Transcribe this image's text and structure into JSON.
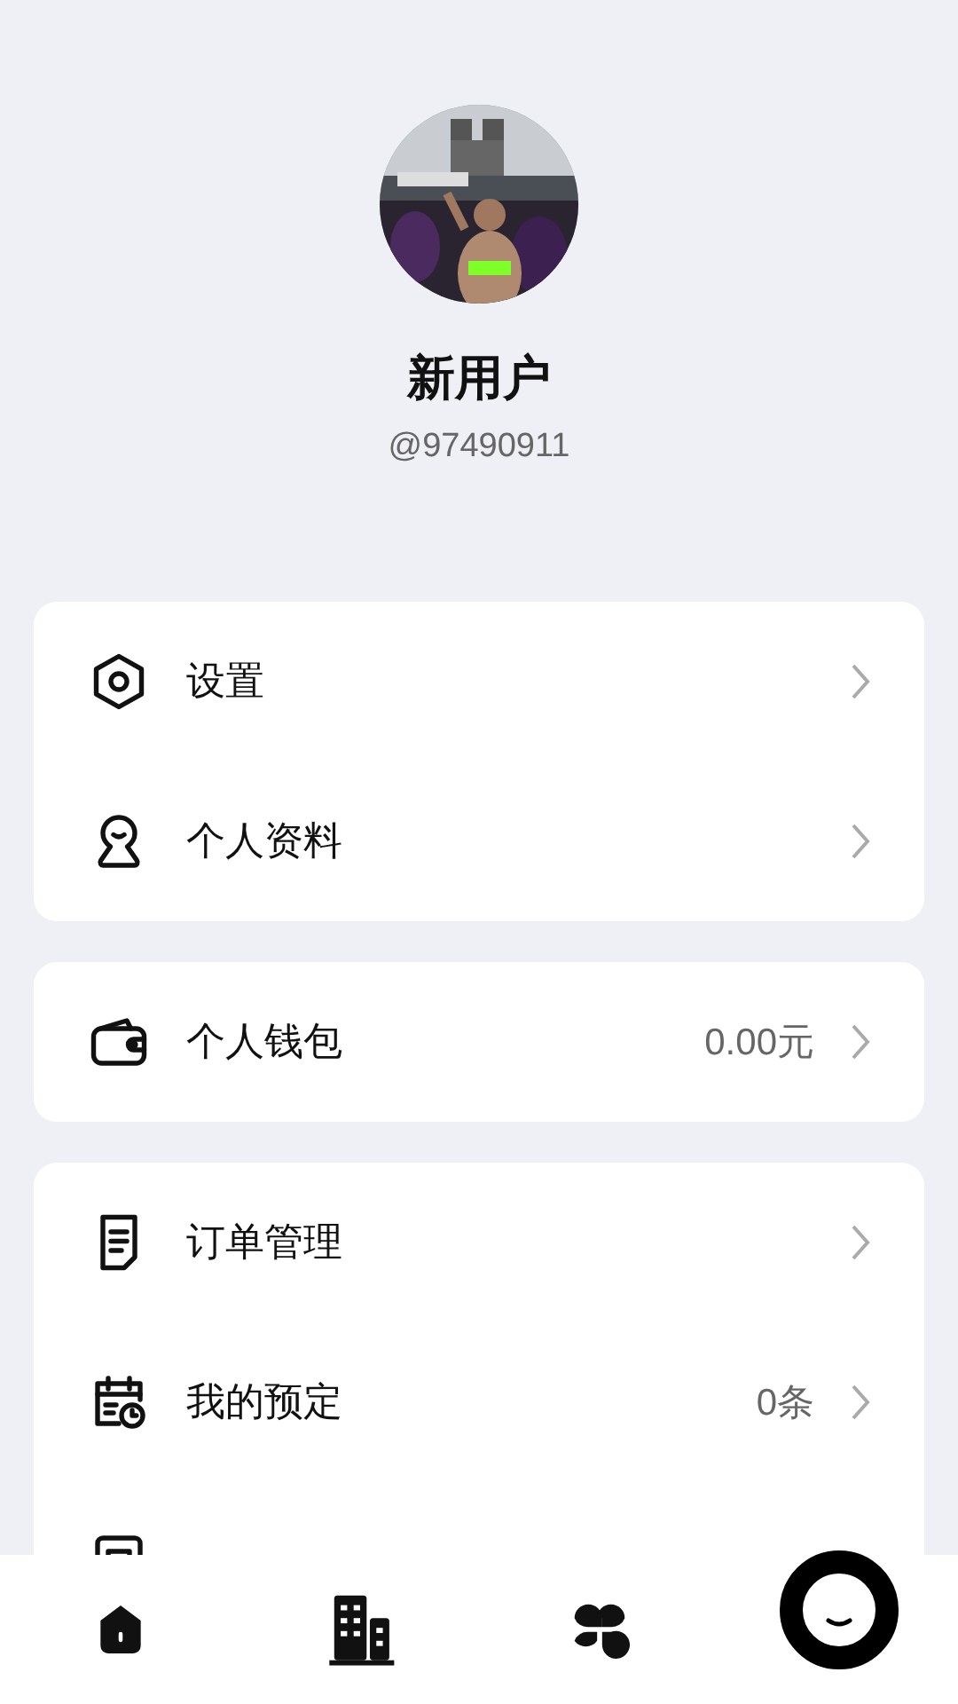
{
  "profile": {
    "name": "新用户",
    "handle": "@97490911"
  },
  "groups": [
    {
      "items": [
        {
          "kind": "settings",
          "label": "设置"
        },
        {
          "kind": "profile",
          "label": "个人资料"
        }
      ]
    },
    {
      "items": [
        {
          "kind": "wallet",
          "label": "个人钱包",
          "value": "0.00元"
        }
      ]
    },
    {
      "items": [
        {
          "kind": "orders",
          "label": "订单管理"
        },
        {
          "kind": "calendar",
          "label": "我的预定",
          "value": "0条"
        },
        {
          "kind": "document"
        }
      ]
    }
  ],
  "tabs": [
    {
      "kind": "home",
      "selected": false
    },
    {
      "kind": "building",
      "selected": false
    },
    {
      "kind": "apps",
      "selected": false
    },
    {
      "kind": "me",
      "selected": true
    }
  ]
}
